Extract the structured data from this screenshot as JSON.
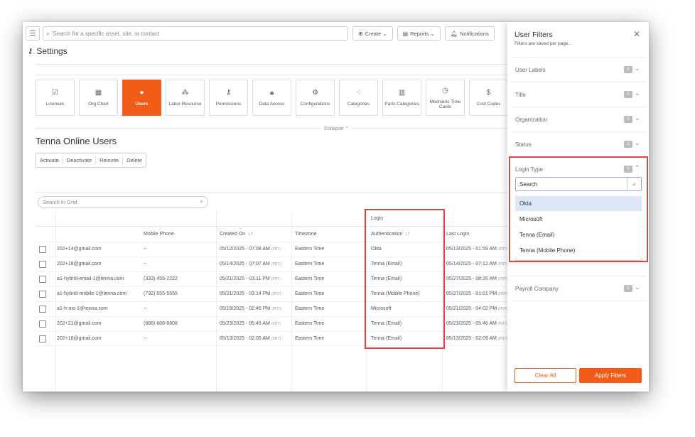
{
  "topbar": {
    "search_placeholder": "Search for a specific asset, site, or contact",
    "create_label": "Create",
    "reports_label": "Reports",
    "notifications_label": "Notifications"
  },
  "page": {
    "title": "Settings"
  },
  "tiles": [
    {
      "label": "Licenses",
      "icon": "license-icon"
    },
    {
      "label": "Org Chart",
      "icon": "org-chart-icon"
    },
    {
      "label": "Users",
      "icon": "user-icon",
      "active": true
    },
    {
      "label": "Labor Resource",
      "icon": "labor-icon"
    },
    {
      "label": "Permissions",
      "icon": "key-icon"
    },
    {
      "label": "Data Access",
      "icon": "lock-icon"
    },
    {
      "label": "Configurations",
      "icon": "config-icon"
    },
    {
      "label": "Categories",
      "icon": "categories-icon"
    },
    {
      "label": "Parts Categories",
      "icon": "parts-icon"
    },
    {
      "label": "Mechanic Time Cards",
      "icon": "clock-icon"
    },
    {
      "label": "Cost Codes",
      "icon": "dollar-icon"
    }
  ],
  "collapse_label": "Collapse",
  "section_title": "Tenna Online Users",
  "actions": [
    "Activate",
    "Deactivate",
    "Reinvite",
    "Delete"
  ],
  "grid": {
    "search_placeholder": "Search In Grid",
    "group_header": "Login",
    "columns": {
      "phone": "Mobile Phone",
      "created": "Created On",
      "timezone": "Timezone",
      "auth": "Authentication",
      "last_login": "Last Login"
    },
    "tz_abbr": "(PDT)",
    "rows": [
      {
        "email": "202+14@gmail.com",
        "phone": "--",
        "created": "05/12/2025 - 07:08 AM",
        "timezone": "Eastern Time",
        "auth": "Okta",
        "last": "05/13/2025 - 01:59 AM"
      },
      {
        "email": "202+18@gmail.com",
        "phone": "--",
        "created": "05/14/2025 - 07:07 AM",
        "timezone": "Eastern Time",
        "auth": "Tenna (Email)",
        "last": "05/14/2025 - 07:12 AM"
      },
      {
        "email": "a1-hybrid-email-1@tenna.com",
        "phone": "(333) 455-2222",
        "created": "05/21/2025 - 03:11 PM",
        "timezone": "Eastern Time",
        "auth": "Tenna (Email)",
        "last": "05/27/2025 - 08:26 AM"
      },
      {
        "email": "a1-hybrid-mobile-1@tenna.com",
        "phone": "(732) 555-5555",
        "created": "05/21/2025 - 03:14 PM",
        "timezone": "Eastern Time",
        "auth": "Tenna (Mobile Phone)",
        "last": "05/27/2025 - 01:01 PM"
      },
      {
        "email": "a1-h-ms-1@tenna.com",
        "phone": "--",
        "created": "05/19/2025 - 02:46 PM",
        "timezone": "Eastern Time",
        "auth": "Microsoft",
        "last": "05/21/2025 - 04:02 PM"
      },
      {
        "email": "202+21@gmail.com",
        "phone": "(888) 888-8808",
        "created": "05/23/2025 - 05:45 AM",
        "timezone": "Eastern Time",
        "auth": "Tenna (Email)",
        "last": "05/23/2025 - 05:46 AM"
      },
      {
        "email": "202+16@gmail.com",
        "phone": "--",
        "created": "05/13/2025 - 02:05 AM",
        "timezone": "Eastern Time",
        "auth": "Tenna (Email)",
        "last": "05/13/2025 - 02:09 AM"
      }
    ]
  },
  "filters": {
    "title": "User Filters",
    "subtitle": "Filters are saved per page...",
    "sections": [
      {
        "label": "User Labels",
        "count": "0"
      },
      {
        "label": "Title",
        "count": "0"
      },
      {
        "label": "Organization",
        "count": "0"
      },
      {
        "label": "Status",
        "count": "1"
      },
      {
        "label": "Login Type",
        "count": "0",
        "open": true
      },
      {
        "label": "Payroll Company",
        "count": "0"
      }
    ],
    "login_search_placeholder": "Search",
    "login_options": [
      "Okta",
      "Microsoft",
      "Tenna (Email)",
      "Tenna (Mobile Phone)"
    ],
    "clear_label": "Clear All",
    "apply_label": "Apply Filters"
  },
  "colors": {
    "accent": "#f25c19",
    "highlight": "#e04343"
  }
}
